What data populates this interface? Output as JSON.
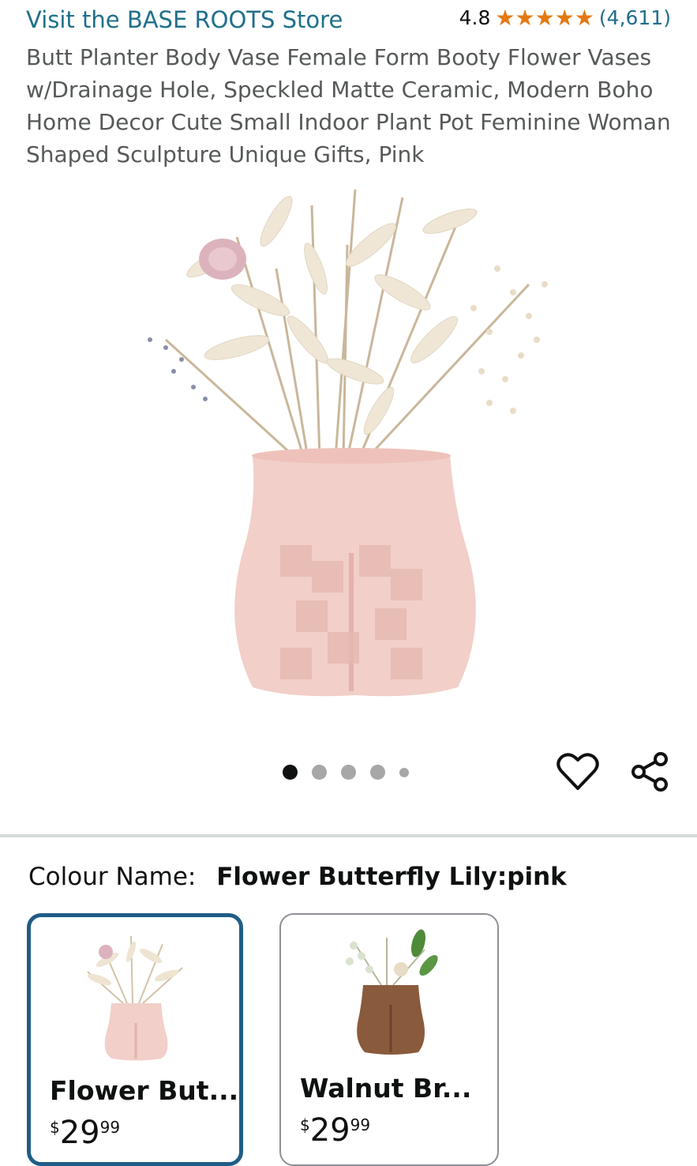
{
  "store": {
    "link_text": "Visit the BASE ROOTS Store"
  },
  "rating": {
    "value": "4.8",
    "stars": 5,
    "count": "(4,611)"
  },
  "product": {
    "title": "Butt Planter Body Vase Female Form Booty Flower Vases w/Drainage Hole, Speckled Matte Ceramic, Modern Boho Home Decor Cute Small Indoor Plant Pot Feminine Woman Shaped Sculpture Unique Gifts, Pink"
  },
  "gallery": {
    "dot_count": 5,
    "active_index": 0
  },
  "icons": {
    "wishlist": "heart-icon",
    "share": "share-icon",
    "rating": "star-icon"
  },
  "colors": {
    "accent_link": "#1f6f8b",
    "star": "#e47911",
    "selected_border": "#1f5d87"
  },
  "variation": {
    "label": "Colour Name:",
    "selected_value": "Flower Butterfly Lily:pink",
    "options": [
      {
        "name": "Flower But...",
        "currency": "$",
        "whole": "29",
        "fraction": "99",
        "selected": true
      },
      {
        "name": "Walnut Br...",
        "currency": "$",
        "whole": "29",
        "fraction": "99",
        "selected": false
      }
    ]
  }
}
